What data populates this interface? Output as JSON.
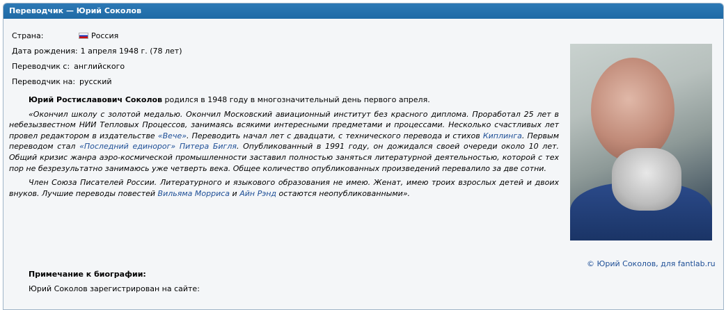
{
  "header": {
    "title": "Переводчик — Юрий Соколов"
  },
  "info": {
    "country_label": "Страна:",
    "country_value": "Россия",
    "birth_label": "Дата рождения:",
    "birth_value": "1 апреля 1948 г. (78 лет)",
    "from_label": "Переводчик с:",
    "from_value": "английского",
    "to_label": "Переводчик на:",
    "to_value": "русский"
  },
  "bio": {
    "p1_name": "Юрий Ростиславович Соколов",
    "p1_rest": " родился в 1948 году в многозначительный день первого апреля.",
    "p2_a": "«Окончил школу с золотой медалью. Окончил Московский авиационный институт без красного диплома. Проработал 25 лет в небезызвестном НИИ Тепловых Процессов, занимаясь всякими интересными предметами и процессами. Несколько счастливых лет провел редактором в издательстве ",
    "p2_link1": "«Вече»",
    "p2_b": ". Переводить начал лет с двадцати, с технического перевода и стихов ",
    "p2_link2": "Киплинга",
    "p2_c": ". Первым переводом стал ",
    "p2_link3": "«Последний единорог»",
    "p2_d": " ",
    "p2_link4": "Питера Бигля",
    "p2_e": ". Опубликованный в 1991 году, он дожидался своей очереди около 10 лет. Общий кризис жанра аэро-космической промышленности заставил полностью заняться литературной деятельностью, которой с тех пор не безрезультатно занимаюсь уже четверть века. Общее количество опубликованных произведений перевалило за две сотни.",
    "p3_a": "Член Союза Писателей России. Литературного и языкового образования не имею. Женат, имею троих взрослых детей и двоих внуков. Лучшие переводы повестей ",
    "p3_link1": "Вильяма Морриса",
    "p3_b": " и ",
    "p3_link2": "Айн Рэнд",
    "p3_c": " остаются неопубликованными»."
  },
  "photo": {
    "credit": "© Юрий Соколов, для fantlab.ru"
  },
  "note": {
    "heading": "Примечание к биографии:",
    "text": "Юрий Соколов зарегистрирован на сайте:"
  }
}
